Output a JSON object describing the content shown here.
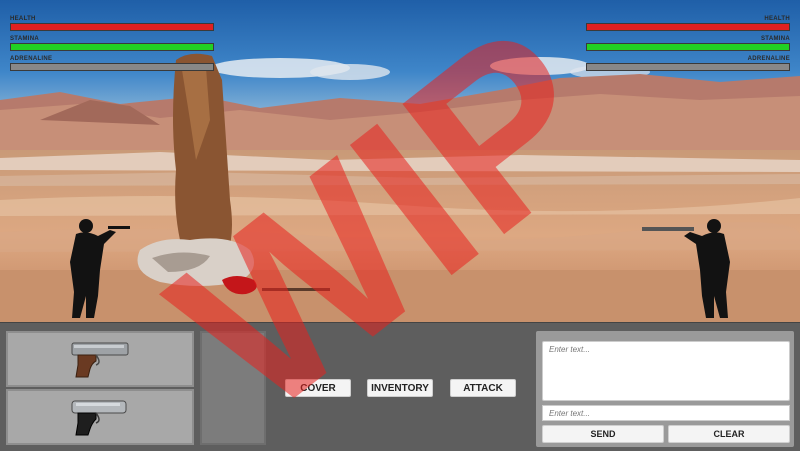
{
  "player": {
    "health_label": "HEALTH",
    "stamina_label": "STAMINA",
    "adrenaline_label": "ADRENALINE",
    "health": 1.0,
    "stamina": 1.0,
    "adrenaline": 0.0
  },
  "enemy": {
    "health_label": "HEALTH",
    "stamina_label": "STAMINA",
    "adrenaline_label": "ADRENALINE",
    "health": 1.0,
    "stamina": 1.0,
    "adrenaline": 0.0
  },
  "inventory": {
    "slot_1": "pistol-colt-icon",
    "slot_2": "pistol-walther-icon"
  },
  "actions": {
    "cover": "COVER",
    "inventory": "INVENTORY",
    "attack": "ATTACK"
  },
  "chat": {
    "area_placeholder": "Enter text...",
    "input_placeholder": "Enter text...",
    "send": "SEND",
    "clear": "CLEAR"
  },
  "overlay": {
    "watermark": "WIP",
    "color": "#e8201e"
  }
}
